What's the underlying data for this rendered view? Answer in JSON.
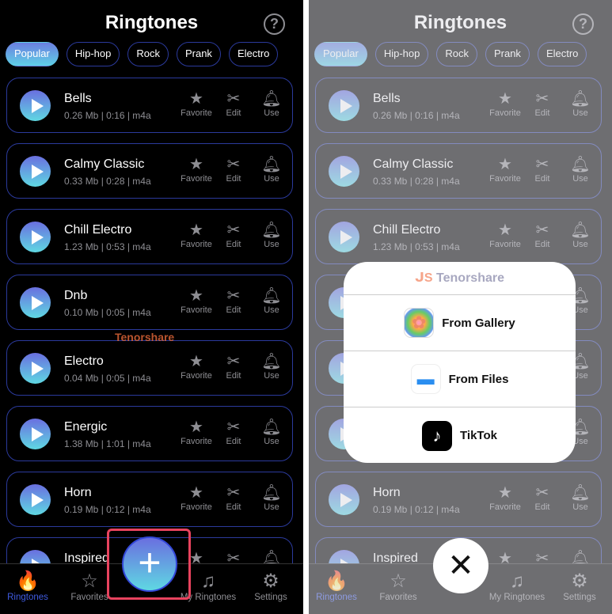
{
  "header": {
    "title": "Ringtones",
    "help_icon": "question-circle-icon"
  },
  "categories": [
    "Popular",
    "Hip-hop",
    "Rock",
    "Prank",
    "Electro"
  ],
  "active_category": "Popular",
  "actions": {
    "favorite": "Favorite",
    "edit": "Edit",
    "use": "Use"
  },
  "ringtones": [
    {
      "name": "Bells",
      "meta": "0.26 Mb | 0:16 | m4a"
    },
    {
      "name": "Calmy Classic",
      "meta": "0.33 Mb | 0:28 | m4a"
    },
    {
      "name": "Chill Electro",
      "meta": "1.23 Mb | 0:53 | m4a"
    },
    {
      "name": "Dnb",
      "meta": "0.10 Mb | 0:05 | m4a"
    },
    {
      "name": "Electro",
      "meta": "0.04 Mb | 0:05 | m4a"
    },
    {
      "name": "Energic",
      "meta": "1.38 Mb | 1:01 | m4a"
    },
    {
      "name": "Horn",
      "meta": "0.19 Mb | 0:12 | m4a"
    },
    {
      "name": "Inspired",
      "meta": ""
    }
  ],
  "tabs": [
    {
      "label": "Ringtones",
      "icon": "flame-icon",
      "active": true
    },
    {
      "label": "Favorites",
      "icon": "star-icon"
    },
    {
      "label": "My Ringtones",
      "icon": "music-note-icon"
    },
    {
      "label": "Settings",
      "icon": "gear-icon"
    }
  ],
  "watermark": "Tenorshare",
  "popup": {
    "logo": "Tenorshare",
    "options": [
      {
        "label": "From Gallery",
        "icon": "photos-icon"
      },
      {
        "label": "From Files",
        "icon": "folder-icon"
      },
      {
        "label": "TikTok",
        "icon": "tiktok-icon"
      }
    ]
  },
  "colors": {
    "accent": "#3f5be0",
    "highlight": "#e8435e"
  }
}
